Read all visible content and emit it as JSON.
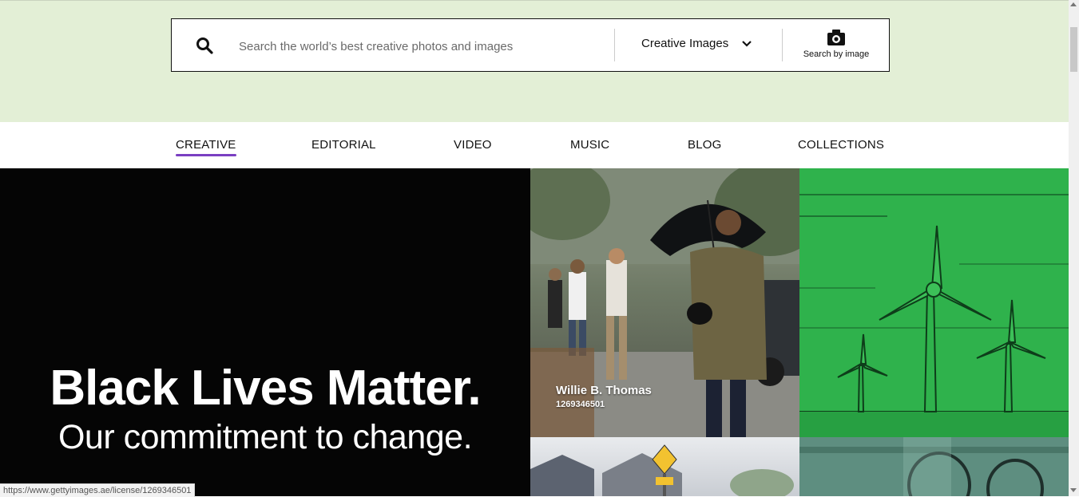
{
  "search": {
    "placeholder": "Search the world’s best creative photos and images",
    "type_label": "Creative Images",
    "search_by_image_label": "Search by image"
  },
  "nav": {
    "items": [
      {
        "label": "CREATIVE",
        "active": true
      },
      {
        "label": "EDITORIAL"
      },
      {
        "label": "VIDEO"
      },
      {
        "label": "MUSIC"
      },
      {
        "label": "BLOG"
      },
      {
        "label": "COLLECTIONS"
      }
    ]
  },
  "hero": {
    "title": "Black Lives Matter.",
    "subtitle": "Our commitment to change."
  },
  "tiles": {
    "photo1": {
      "photographer": "Willie B. Thomas",
      "image_id": "1269346501"
    }
  },
  "status_bar": {
    "url": "https://www.gettyimages.ae/license/1269346501"
  },
  "colors": {
    "top_band": "#e3efd6",
    "nav_active_underline": "#7a3fc2",
    "hero_bg": "#050505",
    "illustration_green": "#2fb24c"
  }
}
